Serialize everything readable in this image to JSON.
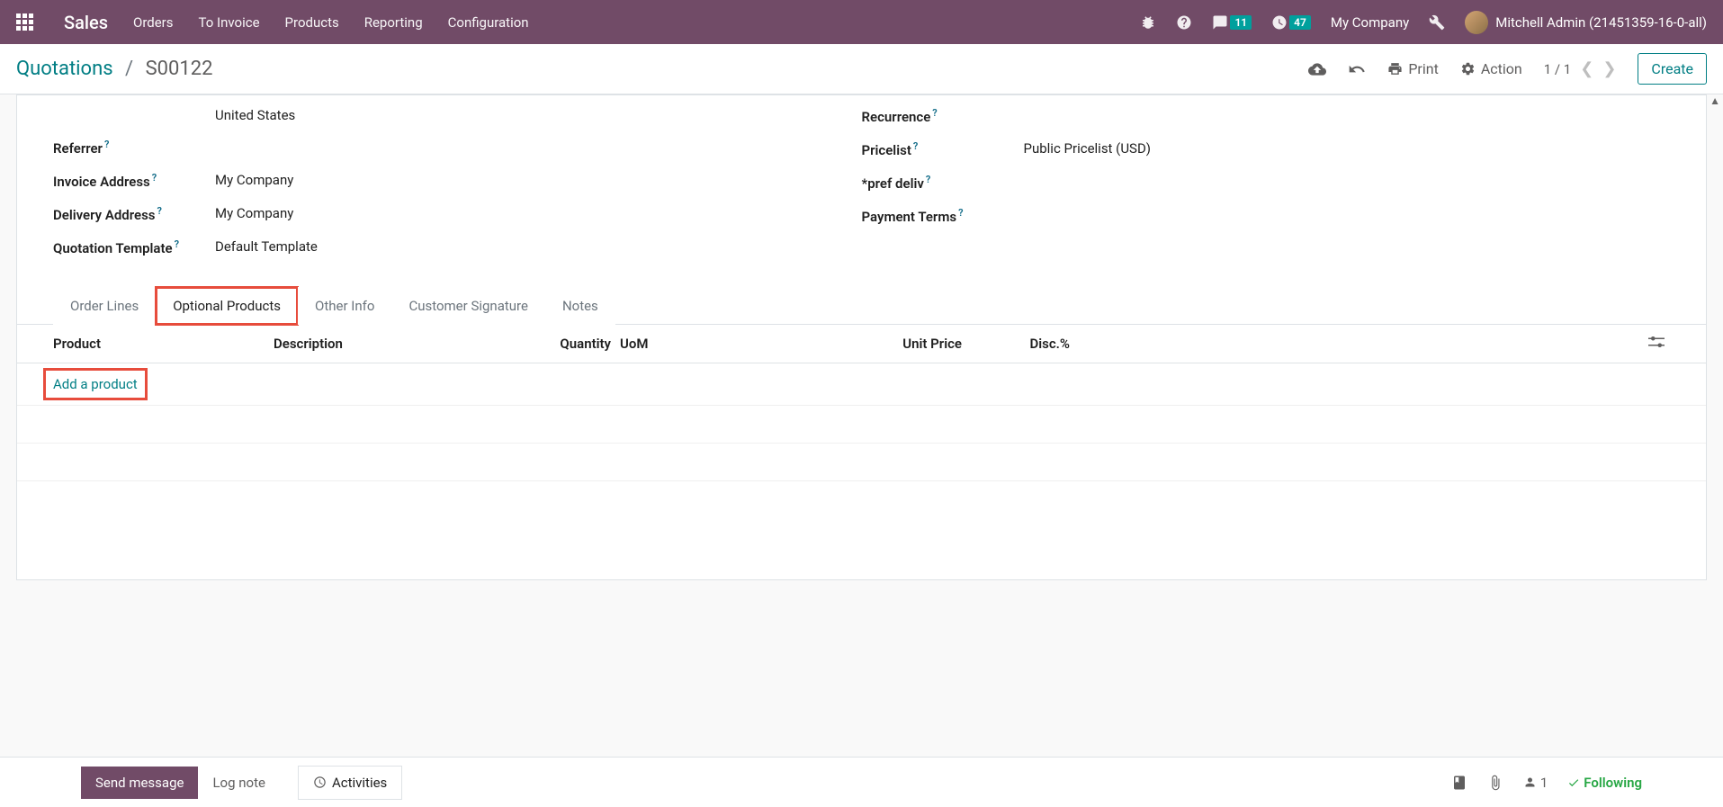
{
  "navbar": {
    "app_name": "Sales",
    "menu": [
      "Orders",
      "To Invoice",
      "Products",
      "Reporting",
      "Configuration"
    ],
    "messages_badge": "11",
    "activities_badge": "47",
    "company": "My Company",
    "user": "Mitchell Admin (21451359-16-0-all)"
  },
  "breadcrumb": {
    "parent": "Quotations",
    "current": "S00122",
    "print": "Print",
    "action": "Action",
    "pager": "1 / 1",
    "create": "Create"
  },
  "form": {
    "left": {
      "country": "United States",
      "referrer_label": "Referrer",
      "invoice_label": "Invoice Address",
      "invoice_value": "My Company",
      "delivery_label": "Delivery Address",
      "delivery_value": "My Company",
      "template_label": "Quotation Template",
      "template_value": "Default Template"
    },
    "right": {
      "recurrence_label": "Recurrence",
      "pricelist_label": "Pricelist",
      "pricelist_value": "Public Pricelist (USD)",
      "pref_deliv_label": "*pref deliv",
      "payment_label": "Payment Terms"
    }
  },
  "tabs": [
    "Order Lines",
    "Optional Products",
    "Other Info",
    "Customer Signature",
    "Notes"
  ],
  "table": {
    "headers": {
      "product": "Product",
      "description": "Description",
      "quantity": "Quantity",
      "uom": "UoM",
      "unit_price": "Unit Price",
      "disc": "Disc.%"
    },
    "add_product": "Add a product"
  },
  "chatter": {
    "send_message": "Send message",
    "log_note": "Log note",
    "activities": "Activities",
    "follower_count": "1",
    "following": "Following"
  }
}
